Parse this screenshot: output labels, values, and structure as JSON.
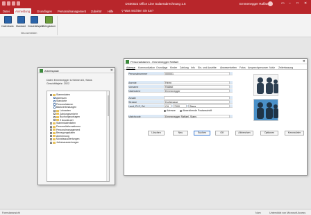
{
  "window": {
    "title": "DS00022 Office Line Salaerabrechnung 1.5",
    "user": "Emmenegger Raffael",
    "tell_me": "Was möchten Sie tun?"
  },
  "ribbon_tabs": [
    "Datei",
    "Anmeldung",
    "Grundlagen",
    "Personalmanagement",
    "Zubehör",
    "Hilfe"
  ],
  "ribbon": {
    "buttons": [
      "Datenbank",
      "Mandant",
      "Geschäftsjahr",
      "Belegdatum"
    ],
    "group_label": "Neu anmelden"
  },
  "arbeitsplatz": {
    "title": "Arbeitsplatz",
    "info_line1": "Datei: Emmenegger & Söhne AG, Stans",
    "info_line2": "Geschäftsjahr: 2022",
    "tree": [
      {
        "label": "Stammdaten",
        "level": 0,
        "kind": "folder"
      },
      {
        "label": "Adressen",
        "level": 1,
        "kind": "doc"
      },
      {
        "label": "Standorte",
        "level": 1,
        "kind": "doc"
      },
      {
        "label": "Personalstamm",
        "level": 1,
        "kind": "doc"
      },
      {
        "label": "Bankverbindungen",
        "level": 1,
        "kind": "doc"
      },
      {
        "label": "Lohnarten",
        "level": 1,
        "kind": "folder"
      },
      {
        "label": "Zahlungsverkehr",
        "level": 1,
        "kind": "folder"
      },
      {
        "label": "Buchungsvorlagen",
        "level": 1,
        "kind": "folder"
      },
      {
        "label": "Z Aussteuert",
        "level": 1,
        "kind": "folder"
      },
      {
        "label": "Stammdatenlisten",
        "level": 0,
        "kind": "folder"
      },
      {
        "label": "Personalinformationen",
        "level": 0,
        "kind": "folder"
      },
      {
        "label": "Personalmanagement",
        "level": 0,
        "kind": "folder"
      },
      {
        "label": "Bewegungsdaten",
        "level": 0,
        "kind": "folder"
      },
      {
        "label": "Abrechnung",
        "level": 0,
        "kind": "folder"
      },
      {
        "label": "Monatsauswertungen",
        "level": 0,
        "kind": "folder"
      },
      {
        "label": "Jahresauswertungen",
        "level": 0,
        "kind": "folder"
      }
    ]
  },
  "personalstamm": {
    "title": "Personalstamm - Emmenegger Raffael",
    "tabs": [
      "Adresse",
      "Kommunikation",
      "Grundlage",
      "Kinder",
      "Zahlung",
      "Info",
      "Ein- und Austritte",
      "Abwesenheiten",
      "Fotos",
      "Ansprechpersonen",
      "Notiz",
      "Zeiterfassung"
    ],
    "fields": {
      "personalnummer_label": "Personalnummer",
      "personalnummer_value": "000001",
      "anrede_label": "Anrede",
      "anrede_value": "Herrn",
      "vorname_label": "Vorname",
      "vorname_value": "Raffael",
      "nachname_label": "Nachname",
      "nachname_value": "Emmenegger",
      "zusatz_label": "Zusatz",
      "zusatz_value": "",
      "strasse_label": "Strasse",
      "strasse_value": "Dorfstrasse",
      "land_label": "Land, PLZ, Ort",
      "land_value": "CH",
      "plz_value": "7000",
      "ort_value": "Stans",
      "matchcode_label": "Matchcode",
      "matchcode_value": "Emmenegger Raffael, Stans"
    },
    "radio_adresse": "Adresse",
    "radio_abweichend": "Abweichende Postanschrift",
    "buttons": [
      "Löschen",
      "Neu",
      "Suchen",
      "OK",
      "Abbrechen",
      "Optionen",
      "Kennwörter"
    ]
  },
  "status": {
    "left": "Formularansicht",
    "mid": "Num",
    "right": "Unterstützt von Microsoft Access"
  }
}
